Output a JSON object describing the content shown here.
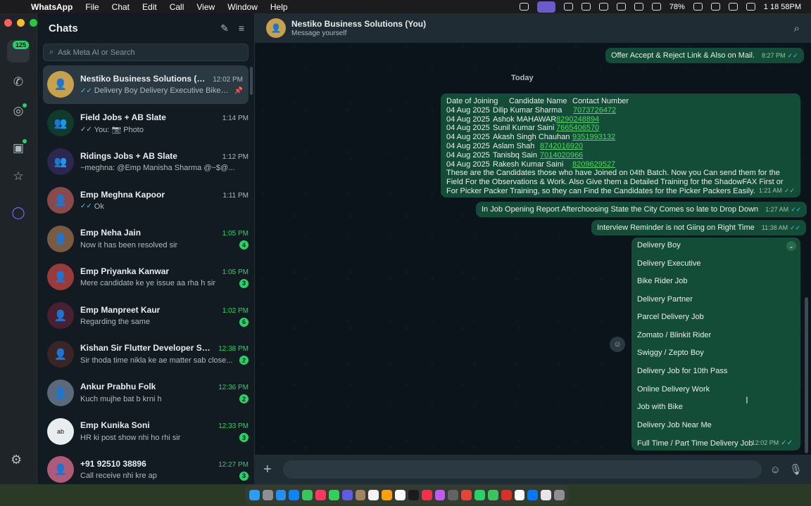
{
  "menubar": {
    "app": "WhatsApp",
    "items": [
      "File",
      "Chat",
      "Edit",
      "Call",
      "View",
      "Window",
      "Help"
    ],
    "battery": "78%",
    "clock": "1 18 58PM"
  },
  "rail": {
    "chats_badge": "125"
  },
  "chatlist": {
    "title": "Chats",
    "search_placeholder": "Ask Meta AI or Search",
    "rows": [
      {
        "name": "Nestiko Business Solutions (You)",
        "time": "12:02 PM",
        "preview": "Delivery Boy Delivery Executive Bike Ri...",
        "tick": "✓✓",
        "pinned": "📌",
        "badge": ""
      },
      {
        "name": "Field Jobs + AB Slate",
        "time": "1:14 PM",
        "preview": "You: 📷 Photo",
        "tick": "✓✓",
        "badge": ""
      },
      {
        "name": "Ridings Jobs + AB Slate",
        "time": "1:12 PM",
        "preview": "~meghna: @Emp Manisha Sharma @~$@...",
        "tick": "",
        "badge": ""
      },
      {
        "name": "Emp Meghna Kapoor",
        "time": "1:11 PM",
        "preview": "Ok",
        "tick": "✓✓",
        "badge": ""
      },
      {
        "name": "Emp Neha Jain",
        "time": "1:05 PM",
        "preview": "Now it has been resolved sir",
        "tick": "",
        "badge": "4"
      },
      {
        "name": "Emp Priyanka Kanwar",
        "time": "1:05 PM",
        "preview": "Mere candidate ke ye issue aa rha h sir",
        "tick": "",
        "badge": "3"
      },
      {
        "name": "Emp Manpreet Kaur",
        "time": "1:02 PM",
        "preview": "Regarding the same",
        "tick": "",
        "badge": "6"
      },
      {
        "name": "Kishan Sir Flutter Developer Surat",
        "time": "12:38 PM",
        "preview": "Sir thoda time nikla ke ae matter sab close...",
        "tick": "",
        "badge": "2"
      },
      {
        "name": "Ankur Prabhu Folk",
        "time": "12:36 PM",
        "preview": "Kuch mujhe bat b krni h",
        "tick": "",
        "badge": "2"
      },
      {
        "name": "Emp Kunika Soni",
        "time": "12:33 PM",
        "preview": "HR ki post show nhi ho rhi sir",
        "tick": "",
        "badge": "3"
      },
      {
        "name": "+91 92510 38896",
        "time": "12:27 PM",
        "preview": "Call receive nhi kre ap",
        "tick": "",
        "badge": "3"
      }
    ]
  },
  "conversation": {
    "title": "Nestiko Business Solutions (You)",
    "subtitle": "Message yourself",
    "prev_message": {
      "text": "Offer Accept & Reject Link & Also on Mail.",
      "time": "8:27 PM"
    },
    "day_label": "Today",
    "table_message": {
      "header": [
        "Date of Joining",
        "Candidate Name",
        "Contact Number"
      ],
      "rows": [
        {
          "date": "04 Aug 2025",
          "name": "Dilip Kumar Sharma",
          "phone": "7073726472"
        },
        {
          "date": "04 Aug 2025",
          "name": "Ashok MAHAWAR",
          "phone": "8290248894"
        },
        {
          "date": "04 Aug 2025",
          "name": "Sunil Kumar Saini",
          "phone": "7665406570"
        },
        {
          "date": "04 Aug 2025",
          "name": "Akash Singh Chauhan",
          "phone": "9351993132"
        },
        {
          "date": "04 Aug 2025",
          "name": "Aslam Shah",
          "phone": "8742016920"
        },
        {
          "date": "04 Aug 2025",
          "name": "Tanisbq Sain",
          "phone": "7014020966"
        },
        {
          "date": "04 Aug 2025",
          "name": "Rakesh Kumar Saini",
          "phone": "8209629527"
        }
      ],
      "paragraph": "These are the Candidates those who have Joined on 04th Batch. Now you Can send them for the Field For the Observations & Work. Also Give them a Detailed Training for the ShadowFAX First or For Picker Packer Training, so they can Find the Candidates for the Picker Packers Easily.",
      "time": "1:21 AM"
    },
    "msg2": {
      "text": "In Job Opening Report Afterchoosing State the City Comes so late to Drop Down",
      "time": "1:27 AM"
    },
    "msg3": {
      "text": "Interview Reminder is not Giing on Right Time",
      "time": "11:38 AM"
    },
    "list_message": {
      "items": [
        "Delivery Boy",
        "Delivery Executive",
        "Bike Rider Job",
        "Delivery Partner",
        "Parcel Delivery Job",
        "Zomato / Blinkit Rider",
        "Swiggy / Zepto Boy",
        "Delivery Job for 10th Pass",
        "Online Delivery Work",
        "Job with Bike",
        "Delivery Job Near Me",
        "Full Time / Part Time Delivery Job"
      ],
      "time": "12:02 PM"
    }
  },
  "colors": {
    "accent": "#25d366",
    "bubble": "#144d37",
    "read_tick": "#53bdeb",
    "link": "#53d769"
  }
}
